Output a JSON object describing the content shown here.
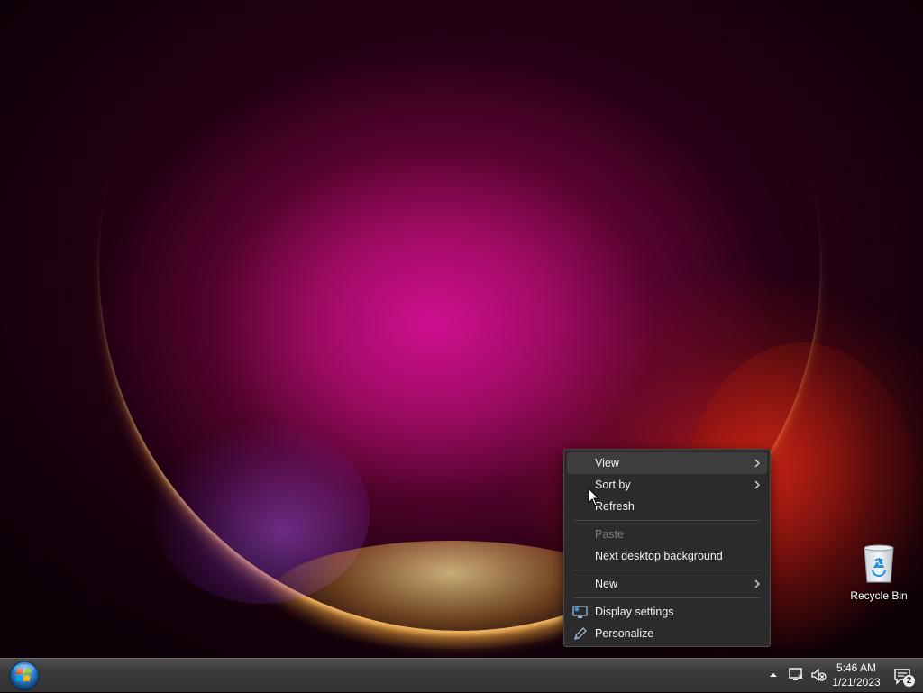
{
  "desktop": {
    "icons": [
      {
        "label": "Recycle Bin",
        "icon": "recycle-bin-icon"
      }
    ]
  },
  "context_menu": {
    "items": [
      {
        "label": "View",
        "submenu": true,
        "highlighted": true
      },
      {
        "label": "Sort by",
        "submenu": true
      },
      {
        "label": "Refresh"
      },
      {
        "label": "Paste",
        "disabled": true
      },
      {
        "label": "Next desktop background"
      },
      {
        "label": "New",
        "submenu": true
      },
      {
        "label": "Display settings",
        "icon": "display-settings-icon"
      },
      {
        "label": "Personalize",
        "icon": "pen-icon"
      }
    ]
  },
  "taskbar": {
    "start_icon": "windows-orb-icon",
    "tray": {
      "icons": [
        "show-hidden-icons-arrow",
        "network-icon",
        "volume-muted-icon",
        "notification-icon"
      ],
      "time": "5:46 AM",
      "date": "1/21/2023",
      "notification_count": "2"
    }
  },
  "colors": {
    "menu_bg": "#2b2b2b",
    "menu_highlight": "#3d3d3d",
    "menu_disabled_text": "#7d7d7d",
    "taskbar_bg": "#3a3a3a"
  }
}
